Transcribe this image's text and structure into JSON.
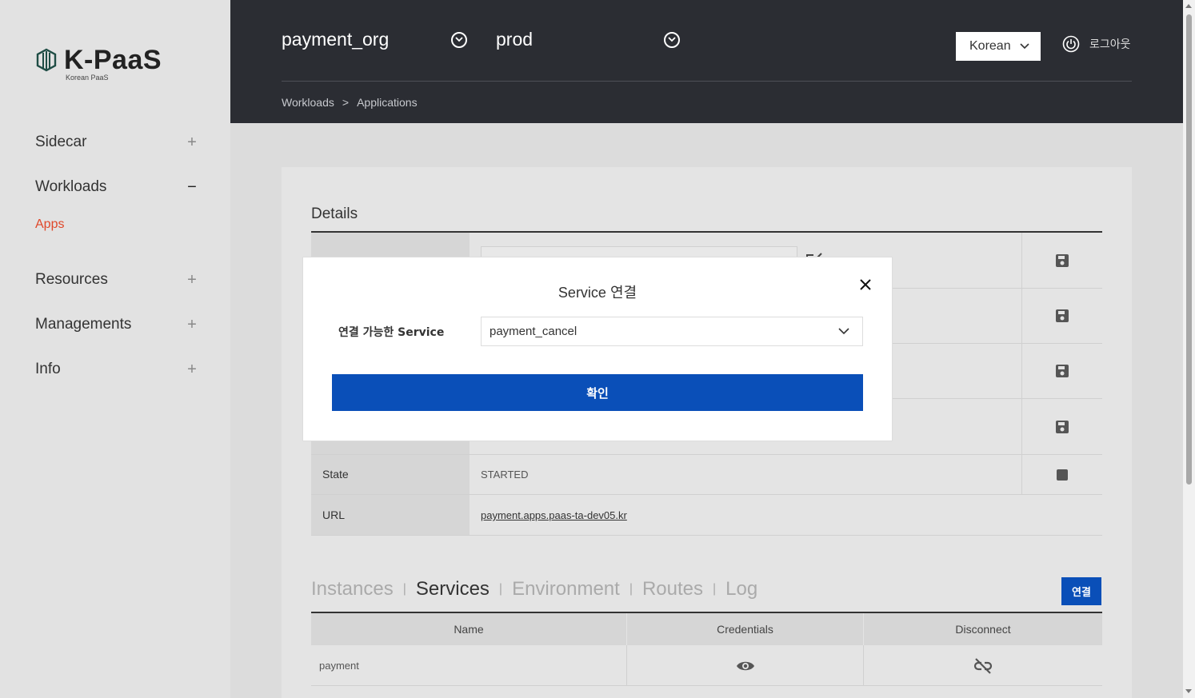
{
  "sidebar": {
    "logo": {
      "title": "K-PaaS",
      "subtitle": "Korean PaaS"
    },
    "items": [
      {
        "label": "Sidecar",
        "toggle": "+"
      },
      {
        "label": "Workloads",
        "toggle": "−",
        "sub": "Apps"
      },
      {
        "label": "Resources",
        "toggle": "+"
      },
      {
        "label": "Managements",
        "toggle": "+"
      },
      {
        "label": "Info",
        "toggle": "+"
      }
    ]
  },
  "header": {
    "org": "payment_org",
    "space": "prod",
    "breadcrumb": [
      "Workloads",
      "Applications"
    ],
    "breadcrumb_sep": ">",
    "language": "Korean",
    "logout": "로그아웃"
  },
  "details": {
    "title": "Details",
    "rows": [
      {
        "key": "State",
        "value": "STARTED"
      },
      {
        "key": "URL",
        "value": "payment.apps.paas-ta-dev05.kr"
      }
    ]
  },
  "tabs": {
    "items": [
      "Instances",
      "Services",
      "Environment",
      "Routes",
      "Log"
    ],
    "active": "Services",
    "connect_button": "연결"
  },
  "services_table": {
    "columns": [
      "Name",
      "Credentials",
      "Disconnect"
    ],
    "rows": [
      {
        "name": "payment"
      }
    ]
  },
  "modal": {
    "title": "Service 연결",
    "label": "연결 가능한 Service",
    "selected": "payment_cancel",
    "confirm": "확인"
  },
  "colors": {
    "header_bg": "#2b2d33",
    "accent_blue": "#0a4fb8",
    "active_nav": "#e0482a"
  },
  "icons": [
    "logo-icon",
    "chevron-circle-icon",
    "power-icon",
    "edit-icon",
    "save-icon",
    "stop-icon",
    "eye-icon",
    "unlink-icon",
    "close-icon",
    "chevron-down-icon"
  ]
}
